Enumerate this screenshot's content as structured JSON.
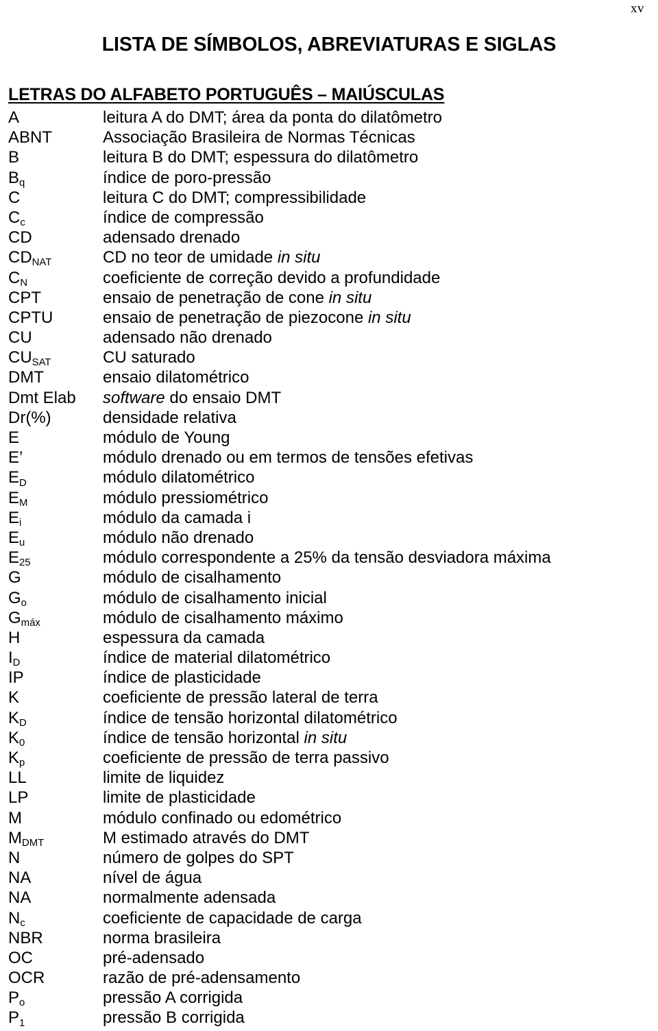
{
  "page": {
    "number": "xv"
  },
  "title": "LISTA DE SÍMBOLOS, ABREVIATURAS E SIGLAS",
  "section": {
    "heading": "LETRAS DO ALFABETO PORTUGUÊS – MAIÚSCULAS"
  },
  "entries": [
    {
      "term": "A",
      "term_sub": "",
      "def_html": "leitura A do DMT; área da ponta do dilatômetro"
    },
    {
      "term": "ABNT",
      "term_sub": "",
      "def_html": "Associação Brasileira de Normas Técnicas"
    },
    {
      "term": "B",
      "term_sub": "",
      "def_html": "leitura B do DMT; espessura do dilatômetro"
    },
    {
      "term": "B",
      "term_sub": "q",
      "def_html": "índice de poro-pressão"
    },
    {
      "term": "C",
      "term_sub": "",
      "def_html": "leitura C do DMT; compressibilidade"
    },
    {
      "term": "C",
      "term_sub": "c",
      "def_html": "índice de compressão"
    },
    {
      "term": "CD",
      "term_sub": "",
      "def_html": "adensado drenado"
    },
    {
      "term": "CD",
      "term_sub": "NAT",
      "def_html": "CD no teor de umidade <i class=\"it\">in situ</i>"
    },
    {
      "term": "C",
      "term_sub": "N",
      "def_html": "coeficiente de correção devido a profundidade"
    },
    {
      "term": "CPT",
      "term_sub": "",
      "def_html": "ensaio de penetração de cone <i class=\"it\">in situ</i>"
    },
    {
      "term": "CPTU",
      "term_sub": "",
      "def_html": "ensaio de penetração de piezocone <i class=\"it\">in situ</i>"
    },
    {
      "term": "CU",
      "term_sub": "",
      "def_html": "adensado não drenado"
    },
    {
      "term": "CU",
      "term_sub": "SAT",
      "def_html": "CU saturado"
    },
    {
      "term": "DMT",
      "term_sub": "",
      "def_html": "ensaio dilatométrico"
    },
    {
      "term": "Dmt Elab",
      "term_sub": "",
      "def_html": "<i class=\"it\">software</i> do ensaio DMT"
    },
    {
      "term": "Dr(%)",
      "term_sub": "",
      "def_html": "densidade relativa"
    },
    {
      "term": "E",
      "term_sub": "",
      "def_html": "módulo de Young"
    },
    {
      "term": "E’",
      "term_sub": "",
      "def_html": "módulo drenado ou em termos de tensões efetivas"
    },
    {
      "term": "E",
      "term_sub": "D",
      "def_html": "módulo dilatométrico"
    },
    {
      "term": "E",
      "term_sub": "M",
      "def_html": "módulo pressiométrico"
    },
    {
      "term": "E",
      "term_sub": "i",
      "def_html": "módulo da camada i"
    },
    {
      "term": "E",
      "term_sub": "u",
      "def_html": "módulo não drenado"
    },
    {
      "term": "E",
      "term_sub": "25",
      "def_html": "módulo correspondente a 25% da tensão desviadora máxima"
    },
    {
      "term": "G",
      "term_sub": "",
      "def_html": "módulo de cisalhamento"
    },
    {
      "term": "G",
      "term_sub": "o",
      "def_html": "módulo de cisalhamento inicial"
    },
    {
      "term": "G",
      "term_sub": "máx",
      "def_html": "módulo de cisalhamento máximo"
    },
    {
      "term": "H",
      "term_sub": "",
      "def_html": "espessura da camada"
    },
    {
      "term": "I",
      "term_sub": "D",
      "def_html": "índice de material dilatométrico"
    },
    {
      "term": "IP",
      "term_sub": "",
      "def_html": "índice de plasticidade"
    },
    {
      "term": "K",
      "term_sub": "",
      "def_html": "coeficiente de pressão lateral de terra"
    },
    {
      "term": "K",
      "term_sub": "D",
      "def_html": "índice de tensão horizontal dilatométrico"
    },
    {
      "term": "K",
      "term_sub": "0",
      "def_html": "índice de tensão horizontal <i class=\"it\">in situ</i>"
    },
    {
      "term": "K",
      "term_sub": "p",
      "def_html": "coeficiente de pressão de terra passivo"
    },
    {
      "term": "LL",
      "term_sub": "",
      "def_html": "limite de liquidez"
    },
    {
      "term": "LP",
      "term_sub": "",
      "def_html": "limite de plasticidade"
    },
    {
      "term": "M",
      "term_sub": "",
      "def_html": "módulo confinado ou edométrico"
    },
    {
      "term": "M",
      "term_sub": "DMT",
      "def_html": "M estimado através do DMT"
    },
    {
      "term": "N",
      "term_sub": "",
      "def_html": "número de golpes do SPT"
    },
    {
      "term": "NA",
      "term_sub": "",
      "def_html": "nível de água"
    },
    {
      "term": "NA",
      "term_sub": "",
      "def_html": "normalmente adensada"
    },
    {
      "term": "N",
      "term_sub": "c",
      "def_html": "coeficiente de capacidade de carga"
    },
    {
      "term": "NBR",
      "term_sub": "",
      "def_html": "norma brasileira"
    },
    {
      "term": "OC",
      "term_sub": "",
      "def_html": "pré-adensado"
    },
    {
      "term": "OCR",
      "term_sub": "",
      "def_html": "razão de pré-adensamento"
    },
    {
      "term": "P",
      "term_sub": "o",
      "def_html": "pressão A corrigida"
    },
    {
      "term": "P",
      "term_sub": "1",
      "def_html": "pressão B corrigida"
    }
  ]
}
